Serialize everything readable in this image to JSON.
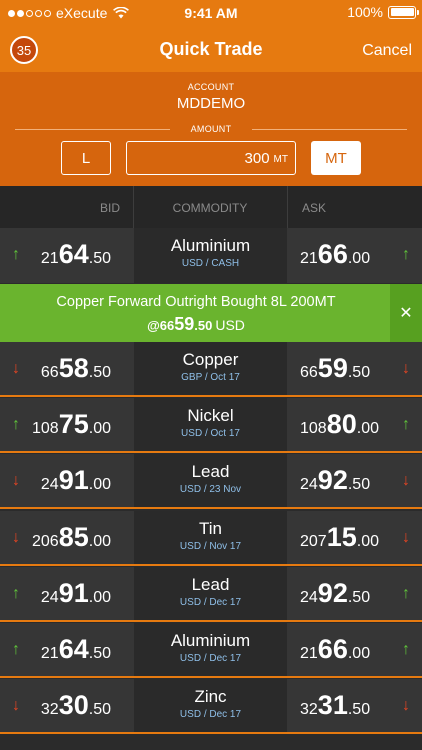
{
  "status": {
    "carrier": "eXecute",
    "time": "9:41 AM",
    "battery": "100%"
  },
  "nav": {
    "counter": "35",
    "title": "Quick Trade",
    "cancel": "Cancel"
  },
  "form": {
    "account_label": "ACCOUNT",
    "account_value": "MDDEMO",
    "amount_label": "AMOUNT",
    "side": "L",
    "amount": "300",
    "amount_unit": "MT",
    "unit_button": "MT"
  },
  "table": {
    "headers": {
      "bid": "BID",
      "commodity": "COMMODITY",
      "ask": "ASK"
    }
  },
  "banner": {
    "text": "Copper Forward Outright Bought 8L 200MT",
    "price_prefix": "@66",
    "price_big": "59",
    "price_dec": ".50",
    "currency": "USD"
  },
  "rows": [
    {
      "dir": "up",
      "name": "Aluminium",
      "sub": "USD / CASH",
      "bid": {
        "p": "21",
        "b": "64",
        "d": ".50"
      },
      "ask": {
        "p": "21",
        "b": "66",
        "d": ".00"
      }
    },
    {
      "dir": "down",
      "name": "Copper",
      "sub": "GBP / Oct 17",
      "bid": {
        "p": "66",
        "b": "58",
        "d": ".50"
      },
      "ask": {
        "p": "66",
        "b": "59",
        "d": ".50"
      }
    },
    {
      "dir": "up",
      "name": "Nickel",
      "sub": "USD / Oct 17",
      "bid": {
        "p": "108",
        "b": "75",
        "d": ".00"
      },
      "ask": {
        "p": "108",
        "b": "80",
        "d": ".00"
      }
    },
    {
      "dir": "down",
      "name": "Lead",
      "sub": "USD / 23 Nov",
      "bid": {
        "p": "24",
        "b": "91",
        "d": ".00"
      },
      "ask": {
        "p": "24",
        "b": "92",
        "d": ".50"
      }
    },
    {
      "dir": "down",
      "name": "Tin",
      "sub": "USD / Nov 17",
      "bid": {
        "p": "206",
        "b": "85",
        "d": ".00"
      },
      "ask": {
        "p": "207",
        "b": "15",
        "d": ".00"
      }
    },
    {
      "dir": "up",
      "name": "Lead",
      "sub": "USD / Dec 17",
      "bid": {
        "p": "24",
        "b": "91",
        "d": ".00"
      },
      "ask": {
        "p": "24",
        "b": "92",
        "d": ".50"
      }
    },
    {
      "dir": "up",
      "name": "Aluminium",
      "sub": "USD / Dec 17",
      "bid": {
        "p": "21",
        "b": "64",
        "d": ".50"
      },
      "ask": {
        "p": "21",
        "b": "66",
        "d": ".00"
      }
    },
    {
      "dir": "down",
      "name": "Zinc",
      "sub": "USD / Dec 17",
      "bid": {
        "p": "32",
        "b": "30",
        "d": ".50"
      },
      "ask": {
        "p": "32",
        "b": "31",
        "d": ".50"
      }
    }
  ]
}
